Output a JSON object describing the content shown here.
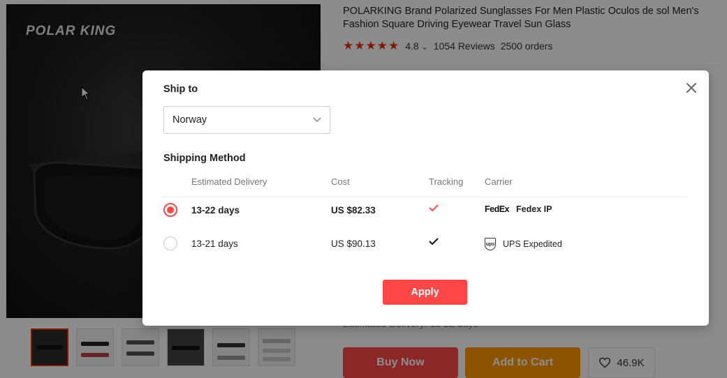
{
  "product": {
    "brand_logo": "POLAR KING",
    "title": "POLARKING Brand Polarized Sunglasses For Men Plastic Oculos de sol Men's Fashion Square Driving Eyewear Travel Sun Glass",
    "rating": "4.8",
    "rating_chevron": "⌄",
    "reviews": "1054 Reviews",
    "orders": "2500 orders",
    "stars": "★★★★★",
    "delivery_hint": "Estimated Delivery: 13-22 days"
  },
  "actions": {
    "buy_now": "Buy Now",
    "add_to_cart": "Add to Cart",
    "wishlist_count": "46.9K"
  },
  "modal": {
    "ship_to_label": "Ship to",
    "country": "Norway",
    "shipping_method_label": "Shipping Method",
    "columns": {
      "delivery": "Estimated Delivery",
      "cost": "Cost",
      "tracking": "Tracking",
      "carrier": "Carrier"
    },
    "rows": [
      {
        "delivery": "13-22 days",
        "cost": "US $82.33",
        "tracking": "✔",
        "carrier": "Fedex IP",
        "carrier_logo": "FedEx",
        "selected": true
      },
      {
        "delivery": "13-21 days",
        "cost": "US $90.13",
        "tracking": "✔",
        "carrier": "UPS Expedited",
        "carrier_logo": "ups",
        "selected": false
      }
    ],
    "apply_label": "Apply"
  },
  "colors": {
    "accent": "#ff4747",
    "orange": "#ff9a00"
  }
}
